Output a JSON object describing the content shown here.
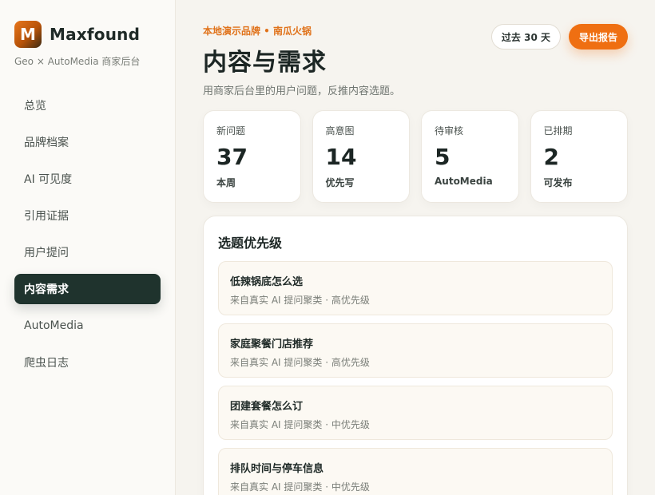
{
  "brand": {
    "logo_letter": "M",
    "name": "Maxfound",
    "subtitle": "Geo × AutoMedia 商家后台"
  },
  "sidebar": {
    "items": [
      {
        "label": "总览"
      },
      {
        "label": "品牌档案"
      },
      {
        "label": "AI 可见度"
      },
      {
        "label": "引用证据"
      },
      {
        "label": "用户提问"
      },
      {
        "label": "内容需求",
        "active": true
      },
      {
        "label": "AutoMedia"
      },
      {
        "label": "爬虫日志"
      }
    ]
  },
  "header": {
    "eyebrow": "本地演示品牌 • 南瓜火锅",
    "title": "内容与需求",
    "subtitle": "用商家后台里的用户问题，反推内容选题。",
    "range_label": "过去 30 天",
    "export_label": "导出报告"
  },
  "stats": [
    {
      "label": "新问题",
      "value": "37",
      "note": "本周"
    },
    {
      "label": "高意图",
      "value": "14",
      "note": "优先写"
    },
    {
      "label": "待审核",
      "value": "5",
      "note": "AutoMedia"
    },
    {
      "label": "已排期",
      "value": "2",
      "note": "可发布"
    }
  ],
  "panel": {
    "title": "选题优先级",
    "topics": [
      {
        "title": "低辣锅底怎么选",
        "meta": "来自真实 AI 提问聚类 · 高优先级"
      },
      {
        "title": "家庭聚餐门店推荐",
        "meta": "来自真实 AI 提问聚类 · 高优先级"
      },
      {
        "title": "团建套餐怎么订",
        "meta": "来自真实 AI 提问聚类 · 中优先级"
      },
      {
        "title": "排队时间与停车信息",
        "meta": "来自真实 AI 提问聚类 · 中优先级"
      }
    ]
  },
  "colors": {
    "accent": "#ef6f12",
    "sidebar_active": "#1f332d",
    "background": "#f6f4ef"
  }
}
